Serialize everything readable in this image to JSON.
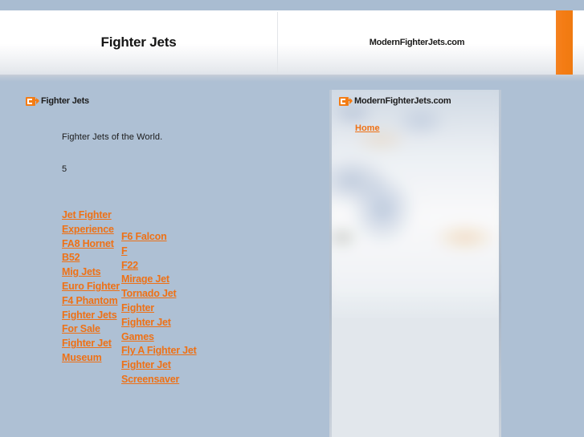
{
  "header": {
    "site_title": "Fighter Jets",
    "site_domain": "ModernFighterJets.com",
    "accent_color": "#f47c14",
    "tab_icon": "orange-tab"
  },
  "colors": {
    "page_background": "#aec0d4",
    "top_bar": "#a9bcd1",
    "header_panel": "#ffffff",
    "link_orange": "#ee7116",
    "accent_orange": "#f47c14",
    "right_panel_lower": "#e2e7ec"
  },
  "left_frame": {
    "icon": "feed-icon",
    "title": "Fighter Jets",
    "intro": "Fighter Jets of the World.",
    "count": "5",
    "links_column_one": [
      "Jet Fighter Experience",
      "FA8 Hornet",
      "B52",
      "Mig Jets",
      "Euro Fighter",
      "F4 Phantom",
      "Fighter Jets For Sale",
      "Fighter Jet Museum"
    ],
    "links_column_two": [
      "F6 Falcon",
      "F",
      "F22",
      "Mirage Jet",
      "Tornado Jet",
      "Fighter",
      "Fighter Jet Games",
      "Fly A Fighter Jet",
      "Fighter Jet Screensaver"
    ]
  },
  "right_frame": {
    "icon": "feed-icon",
    "title": "ModernFighterJets.com",
    "home_link": "Home",
    "background_image": "blurred-desk-laptop-photo"
  }
}
